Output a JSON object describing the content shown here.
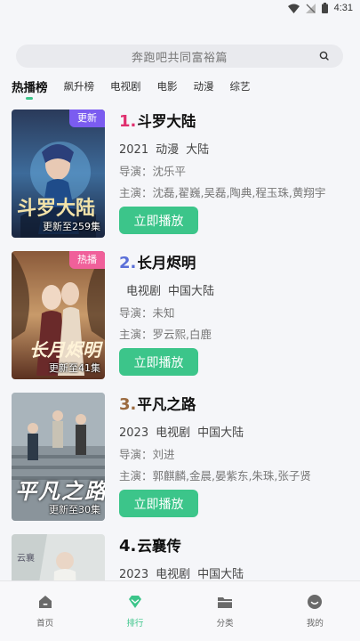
{
  "status_bar": {
    "time": "4:31"
  },
  "search": {
    "placeholder": "奔跑吧共同富裕篇"
  },
  "tabs": [
    "热播榜",
    "飙升榜",
    "电视剧",
    "电影",
    "动漫",
    "综艺"
  ],
  "items": [
    {
      "rank": "1.",
      "rank_color": "#e0306f",
      "title": "斗罗大陆",
      "meta": [
        "2021",
        "动漫",
        "大陆"
      ],
      "director": "导演：沈乐平",
      "cast": "主演：沈磊,翟巍,吴磊,陶典,程玉珠,黄翔宇",
      "badge": "更新",
      "badge_color": "#7b5cf0",
      "episodes": "更新至259集",
      "play_label": "立即播放"
    },
    {
      "rank": "2.",
      "rank_color": "#5a6fd8",
      "title": "长月烬明",
      "meta": [
        "",
        "电视剧",
        "中国大陆"
      ],
      "director": "导演：未知",
      "cast": "主演：罗云熙,白鹿",
      "badge": "热播",
      "badge_color": "#f0609a",
      "episodes": "更新至41集",
      "play_label": "立即播放"
    },
    {
      "rank": "3.",
      "rank_color": "#9b6a3f",
      "title": "平凡之路",
      "meta": [
        "2023",
        "电视剧",
        "中国大陆"
      ],
      "director": "导演：刘进",
      "cast": "主演：郭麒麟,金晨,晏紫东,朱珠,张子贤",
      "badge": "",
      "badge_color": "",
      "poster_title": "平凡之路",
      "episodes": "更新至30集",
      "play_label": "立即播放"
    },
    {
      "rank": "4.",
      "rank_color": "#111111",
      "title": "云襄传",
      "meta": [
        "2023",
        "电视剧",
        "中国大陆"
      ],
      "director": "",
      "cast": "",
      "badge": "",
      "badge_color": "",
      "episodes": "",
      "play_label": ""
    }
  ],
  "nav": [
    {
      "label": "首页",
      "icon": "home-icon"
    },
    {
      "label": "排行",
      "icon": "ranking-icon"
    },
    {
      "label": "分类",
      "icon": "folder-icon"
    },
    {
      "label": "我的",
      "icon": "profile-icon"
    }
  ],
  "accent": "#3cc58a"
}
